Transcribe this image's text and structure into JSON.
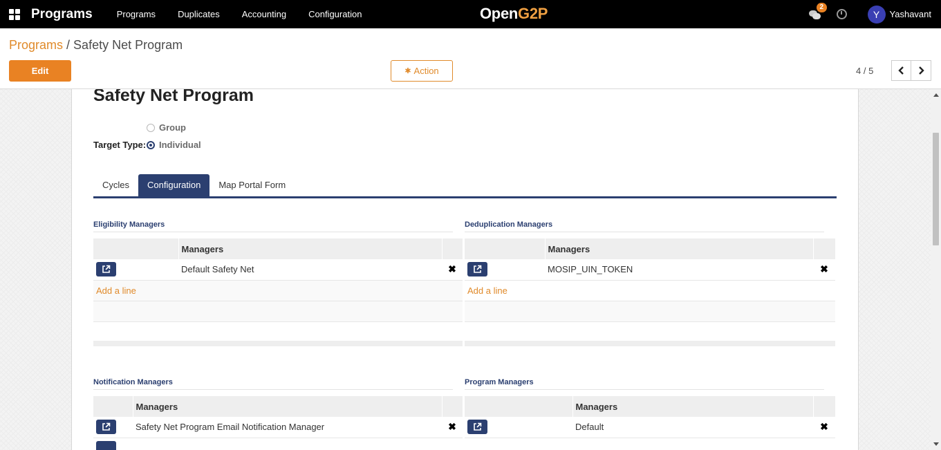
{
  "navbar": {
    "app_title": "Programs",
    "menu": [
      "Programs",
      "Duplicates",
      "Accounting",
      "Configuration"
    ],
    "brand_part1": "Open",
    "brand_part2": "G2P",
    "notification_count": "2",
    "user_initial": "Y",
    "user_name": "Yashavant"
  },
  "breadcrumb": {
    "parent": "Programs",
    "separator": " / ",
    "current": "Safety Net Program"
  },
  "buttons": {
    "edit": "Edit",
    "action": "Action"
  },
  "pager": {
    "text": "4 / 5",
    "prev_icon": "chevron-left-icon",
    "next_icon": "chevron-right-icon"
  },
  "record": {
    "title": "Safety Net Program",
    "target_type_label": "Target Type:",
    "options": [
      "Group",
      "Individual"
    ],
    "selected": "Individual"
  },
  "tabs": [
    "Cycles",
    "Configuration",
    "Map Portal Form"
  ],
  "active_tab": "Configuration",
  "sections": {
    "eligibility": {
      "title": "Eligibility Managers",
      "column": "Managers",
      "rows": [
        "Default Safety Net"
      ],
      "add_line": "Add a line"
    },
    "deduplication": {
      "title": "Deduplication Managers",
      "column": "Managers",
      "rows": [
        "MOSIP_UIN_TOKEN"
      ],
      "add_line": "Add a line"
    },
    "notification": {
      "title": "Notification Managers",
      "column": "Managers",
      "rows": [
        "Safety Net Program Email Notification Manager"
      ]
    },
    "program": {
      "title": "Program Managers",
      "column": "Managers",
      "rows": [
        "Default"
      ]
    }
  },
  "colors": {
    "accent": "#e98223",
    "primary": "#2b3f70",
    "navbar": "#000000"
  }
}
